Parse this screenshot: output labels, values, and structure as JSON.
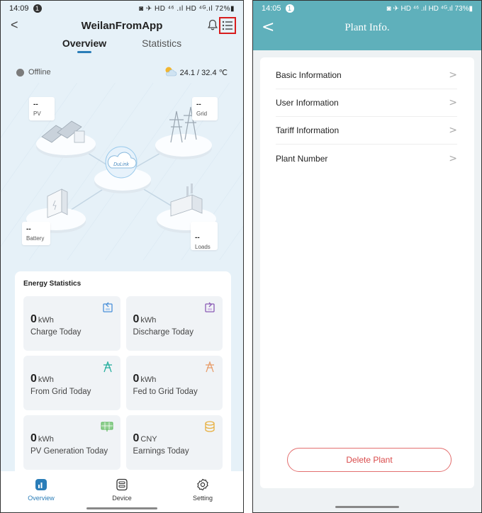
{
  "left": {
    "status_bar": {
      "time": "14:09",
      "notif": "1",
      "right": "◙ ✈ HD ⁴⁶ .ıl HD ⁴ᴳ.ıl 72%▮"
    },
    "header": {
      "back": "<",
      "title": "WeilanFromApp"
    },
    "tabs": [
      {
        "label": "Overview"
      },
      {
        "label": "Statistics"
      }
    ],
    "status": "Offline",
    "weather": "24.1 / 32.4 ℃",
    "nodes": {
      "pv": {
        "value": "--",
        "label": "PV"
      },
      "grid": {
        "value": "--",
        "label": "Grid"
      },
      "battery": {
        "value": "--",
        "label": "Battery"
      },
      "loads": {
        "value": "--",
        "label": "Loads"
      }
    },
    "hub_text": "DuLink",
    "energy": {
      "title": "Energy Statistics",
      "tiles": [
        {
          "value": "0",
          "unit": "kWh",
          "label": "Charge Today",
          "icon": "charge-icon",
          "color": "#4a90d9"
        },
        {
          "value": "0",
          "unit": "kWh",
          "label": "Discharge Today",
          "icon": "discharge-icon",
          "color": "#8a5ab5"
        },
        {
          "value": "0",
          "unit": "kWh",
          "label": "From Grid Today",
          "icon": "grid-tower-icon",
          "color": "#2ab0a0"
        },
        {
          "value": "0",
          "unit": "kWh",
          "label": "Fed to Grid Today",
          "icon": "grid-tower-icon",
          "color": "#e8a070"
        },
        {
          "value": "0",
          "unit": "kWh",
          "label": "PV Generation Today",
          "icon": "solar-panel-icon",
          "color": "#5cb85c"
        },
        {
          "value": "0",
          "unit": "CNY",
          "label": "Earnings Today",
          "icon": "coins-icon",
          "color": "#e8b040"
        }
      ]
    },
    "bottom_nav": [
      {
        "label": "Overview"
      },
      {
        "label": "Device"
      },
      {
        "label": "Setting"
      }
    ]
  },
  "right": {
    "status_bar": {
      "time": "14:05",
      "notif": "1",
      "right": "◙ ✈ HD ⁴⁶ .ıl HD ⁴ᴳ.ıl 73%▮"
    },
    "header": {
      "back": "<",
      "title": "Plant Info."
    },
    "items": [
      {
        "label": "Basic Information"
      },
      {
        "label": "User Information"
      },
      {
        "label": "Tariff Information"
      },
      {
        "label": "Plant Number"
      }
    ],
    "chevron": ">",
    "delete_label": "Delete Plant"
  }
}
